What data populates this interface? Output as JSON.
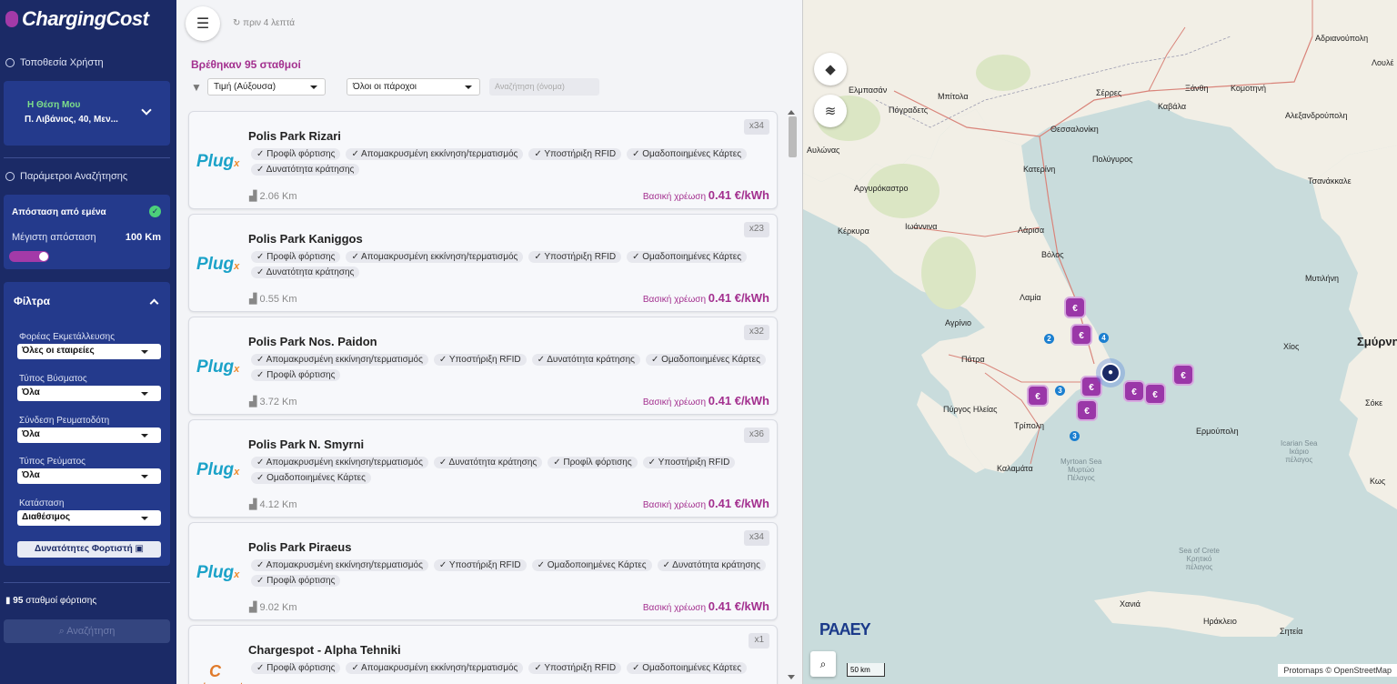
{
  "app": {
    "title": "ChargingCost"
  },
  "sidebar": {
    "user_location_title": "Τοποθεσία Χρήστη",
    "location": {
      "label": "Η Θέση Μου",
      "address": "Π. Λιβάνιος, 40, Μεν..."
    },
    "search_params_title": "Παράμετροι Αναζήτησης",
    "distance": {
      "title": "Απόσταση από εμένα",
      "max_label": "Μέγιστη απόσταση",
      "max_value": "100 Km",
      "enabled": true
    },
    "filters": {
      "title": "Φίλτρα",
      "items": [
        {
          "label": "Φορέας Εκμετάλλευσης",
          "value": "Όλες οι εταιρείες"
        },
        {
          "label": "Τύπος Βύσματος",
          "value": "Όλα"
        },
        {
          "label": "Σύνδεση Ρευματοδότη",
          "value": "Όλα"
        },
        {
          "label": "Τύπος Ρεύματος",
          "value": "Όλα"
        },
        {
          "label": "Κατάσταση",
          "value": "Διαθέσιμος"
        }
      ],
      "capabilities_button": "Δυνατότητες Φορτιστή"
    },
    "stations_count": "95",
    "stations_count_label": "σταθμοί φόρτισης",
    "search_button": "Αναζήτηση"
  },
  "list": {
    "refresh_text": "πριν 4 λεπτά",
    "found_text": "Βρέθηκαν 95 σταθμοί",
    "sort_value": "Τιμή (Αύξουσα)",
    "provider_value": "Όλοι οι πάροχοι",
    "search_placeholder": "Αναζήτηση (όνομα)",
    "price_label": "Βασική χρέωση",
    "cards": [
      {
        "brand": "Plug",
        "name": "Polis Park Rizari",
        "count": "x34",
        "tags": [
          "✓ Προφίλ φόρτισης",
          "✓ Απομακρυσμένη εκκίνηση/τερματισμός",
          "✓ Υποστήριξη RFID",
          "✓ Ομαδοποιημένες Κάρτες",
          "✓ Δυνατότητα κράτησης"
        ],
        "distance": "2.06 Km",
        "price": "0.41 €/kWh"
      },
      {
        "brand": "Plug",
        "name": "Polis Park Kaniggos",
        "count": "x23",
        "tags": [
          "✓ Προφίλ φόρτισης",
          "✓ Απομακρυσμένη εκκίνηση/τερματισμός",
          "✓ Υποστήριξη RFID",
          "✓ Ομαδοποιημένες Κάρτες",
          "✓ Δυνατότητα κράτησης"
        ],
        "distance": "0.55 Km",
        "price": "0.41 €/kWh"
      },
      {
        "brand": "Plug",
        "name": "Polis Park Nos. Paidon",
        "count": "x32",
        "tags": [
          "✓ Απομακρυσμένη εκκίνηση/τερματισμός",
          "✓ Υποστήριξη RFID",
          "✓ Δυνατότητα κράτησης",
          "✓ Ομαδοποιημένες Κάρτες",
          "✓ Προφίλ φόρτισης"
        ],
        "distance": "3.72 Km",
        "price": "0.41 €/kWh"
      },
      {
        "brand": "Plug",
        "name": "Polis Park N. Smyrni",
        "count": "x36",
        "tags": [
          "✓ Απομακρυσμένη εκκίνηση/τερματισμός",
          "✓ Δυνατότητα κράτησης",
          "✓ Προφίλ φόρτισης",
          "✓ Υποστήριξη RFID",
          "✓ Ομαδοποιημένες Κάρτες"
        ],
        "distance": "4.12 Km",
        "price": "0.41 €/kWh"
      },
      {
        "brand": "Plug",
        "name": "Polis Park Piraeus",
        "count": "x34",
        "tags": [
          "✓ Απομακρυσμένη εκκίνηση/τερματισμός",
          "✓ Υποστήριξη RFID",
          "✓ Ομαδοποιημένες Κάρτες",
          "✓ Δυνατότητα κράτησης",
          "✓ Προφίλ φόρτισης"
        ],
        "distance": "9.02 Km",
        "price": "0.41 €/kWh"
      },
      {
        "brand": "chargespot",
        "name": "Chargespot - Alpha Tehniki",
        "count": "x1",
        "tags": [
          "✓ Προφίλ φόρτισης",
          "✓ Απομακρυσμένη εκκίνηση/τερματισμός",
          "✓ Υποστήριξη RFID",
          "✓ Ομαδοποιημένες Κάρτες"
        ],
        "distance": "",
        "price": ""
      }
    ]
  },
  "map": {
    "labels": [
      {
        "t": "Αδριανούπολη"
      },
      {
        "t": "Λουλέ"
      },
      {
        "t": "Ξάνθη"
      },
      {
        "t": "Κομοτηνή"
      },
      {
        "t": "Σέρρες"
      },
      {
        "t": "Ελμπασάν"
      },
      {
        "t": "Μπίτολα"
      },
      {
        "t": "Πόγραδετς"
      },
      {
        "t": "Καβάλα"
      },
      {
        "t": "Αλεξανδρούπολη"
      },
      {
        "t": "Θεσσαλονίκη"
      },
      {
        "t": "Αυλώνας"
      },
      {
        "t": "Κατερίνη"
      },
      {
        "t": "Πολύγυρος"
      },
      {
        "t": "Αργυρόκαστρο"
      },
      {
        "t": "Τσανάκκαλε"
      },
      {
        "t": "Ιωάννινα"
      },
      {
        "t": "Κέρκυρα"
      },
      {
        "t": "Λάρισα"
      },
      {
        "t": "Βόλος"
      },
      {
        "t": "Μυτιλήνη"
      },
      {
        "t": "Λαμία"
      },
      {
        "t": "Αγρίνιο"
      },
      {
        "t": "Χίος"
      },
      {
        "t": "Σμύρνη"
      },
      {
        "t": "Πάτρα"
      },
      {
        "t": "Σόκε"
      },
      {
        "t": "Πύργος Ηλείας"
      },
      {
        "t": "Τρίπολη"
      },
      {
        "t": "Ερμούπολη"
      },
      {
        "t": "Καλαμάτα"
      },
      {
        "t": "Κως"
      },
      {
        "t": "Χανιά"
      },
      {
        "t": "Ηράκλειο"
      },
      {
        "t": "Σητεία"
      }
    ],
    "seas": [
      {
        "t1": "Myrtoan Sea",
        "t2": "Μυρτώο",
        "t3": "Πέλαγος"
      },
      {
        "t1": "Icarian Sea",
        "t2": "Ικάριο",
        "t3": "πέλαγος"
      },
      {
        "t1": "Sea of Crete",
        "t2": "Κρητικό",
        "t3": "πέλαγος"
      }
    ],
    "clusters": [
      "€",
      "€",
      "€",
      "€",
      "€",
      "€",
      "€",
      "€"
    ],
    "dots": [
      "2",
      "4",
      "3",
      "3"
    ],
    "logo": "PAAEY",
    "scale": "50 km",
    "attribution": "Protomaps © OpenStreetMap"
  }
}
